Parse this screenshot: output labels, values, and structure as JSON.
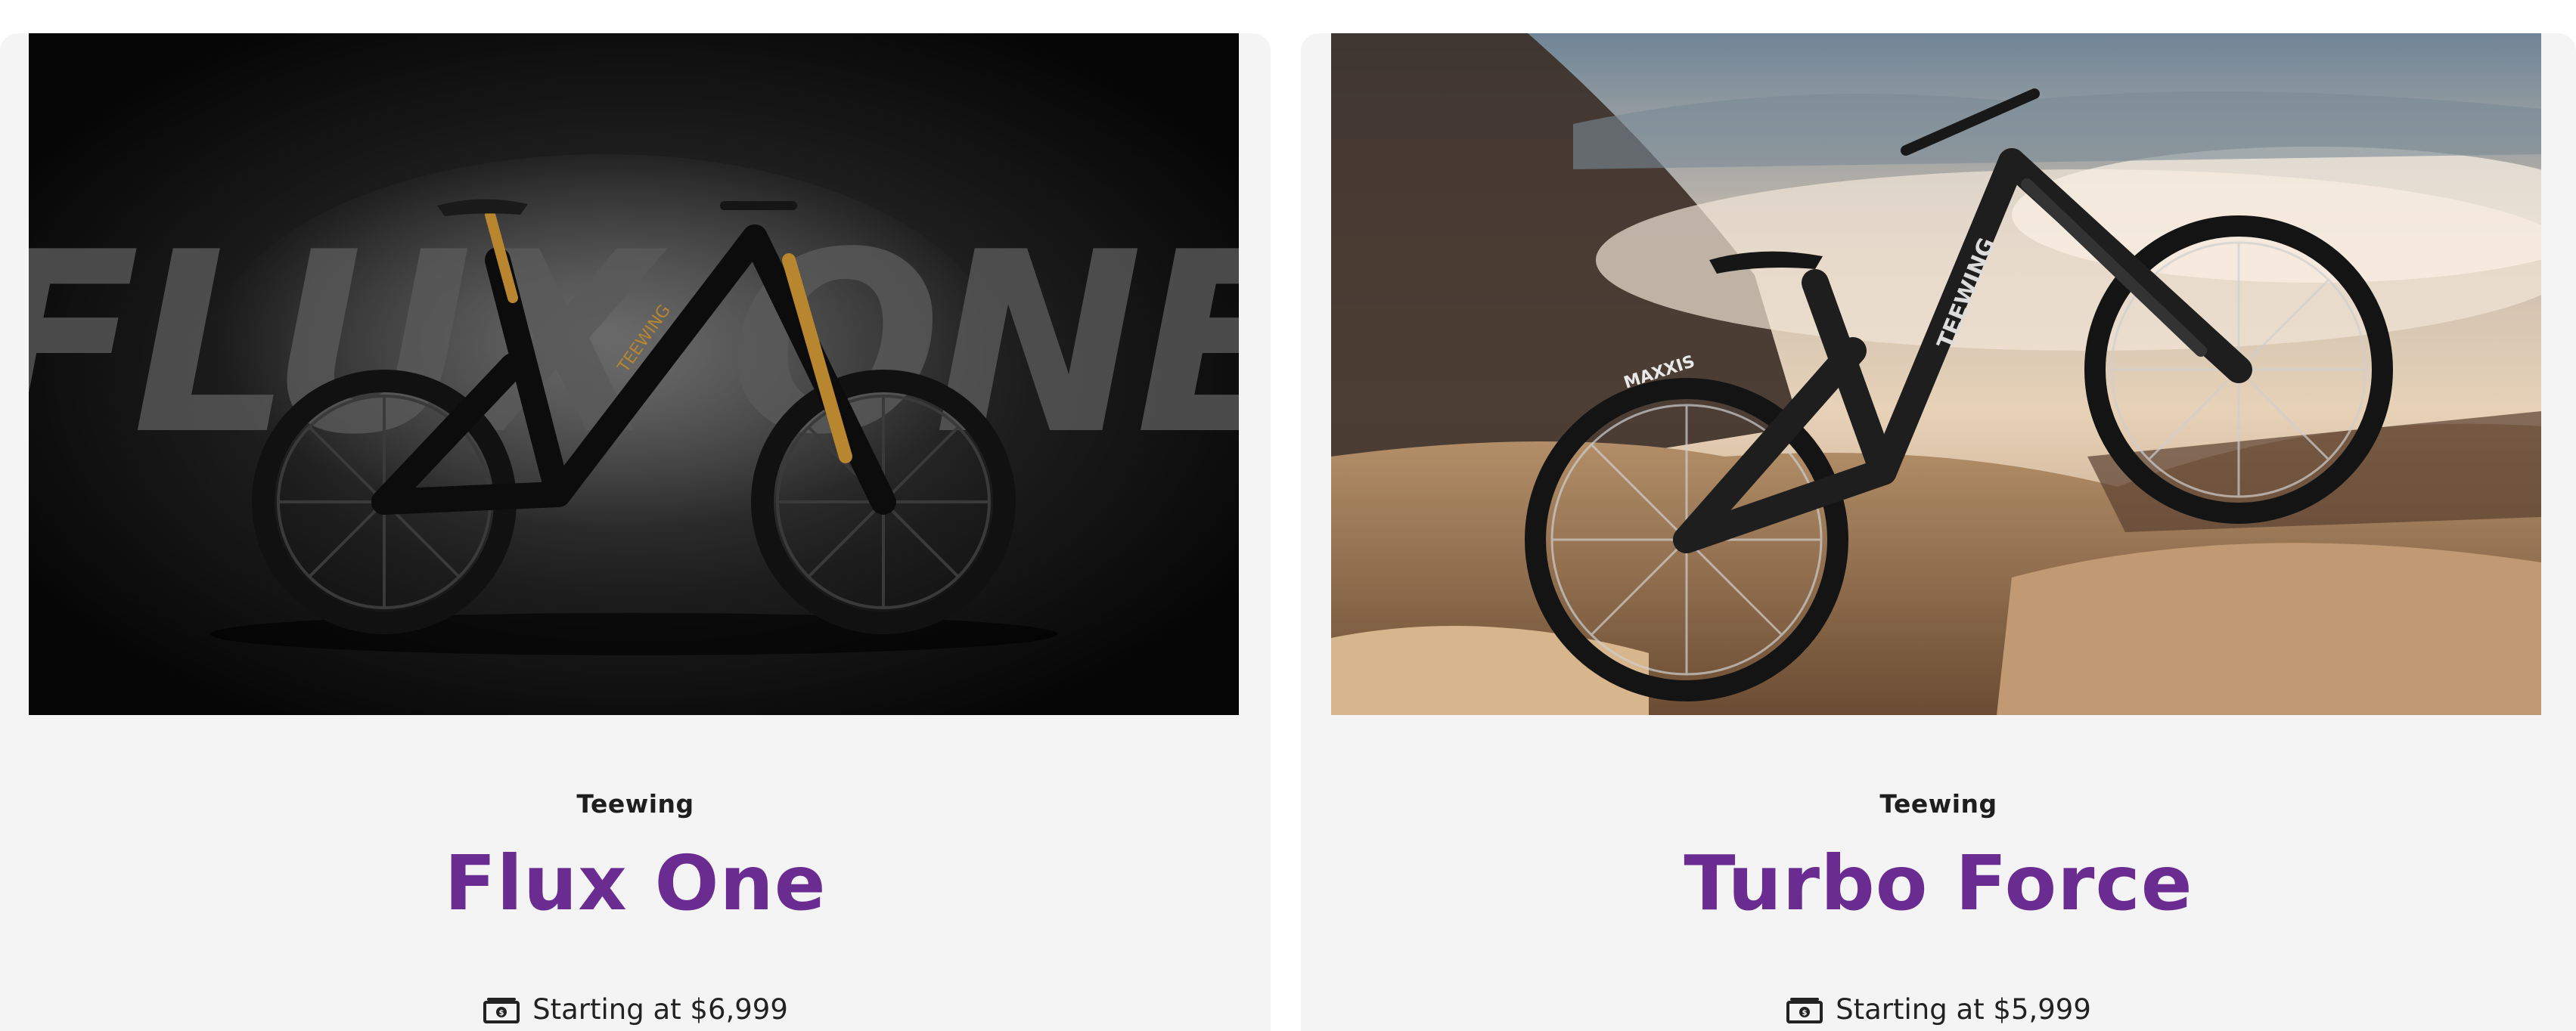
{
  "products": [
    {
      "brand": "Teewing",
      "name": "Flux One",
      "price_text": "Starting at $6,999",
      "image_text": "FLUX ONE",
      "bike_brand_mark": "TEEWING",
      "accent_color": "#6a2c91"
    },
    {
      "brand": "Teewing",
      "name": "Turbo Force",
      "price_text": "Starting at $5,999",
      "tire_text": "MAXXIS",
      "bike_brand_mark": "TEEWING",
      "accent_color": "#6a2c91"
    }
  ],
  "icons": {
    "price": "money-icon"
  }
}
